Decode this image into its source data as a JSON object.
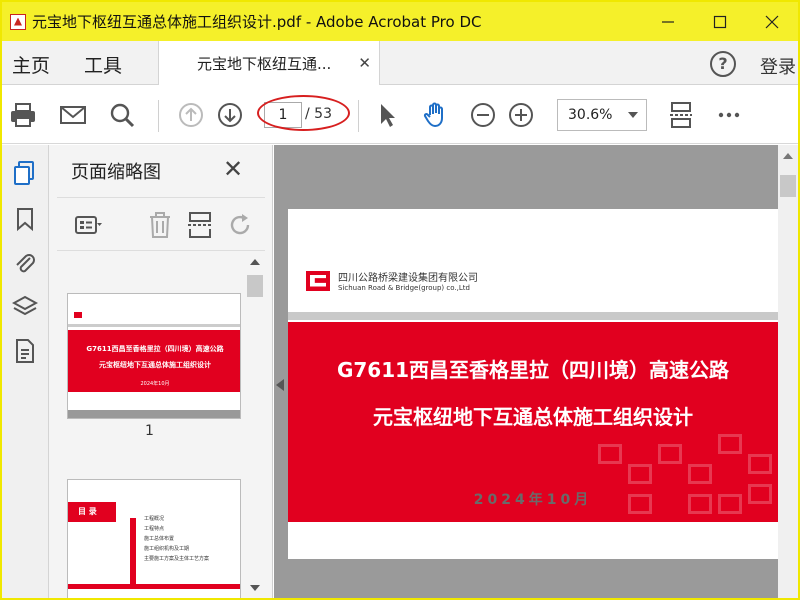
{
  "window": {
    "title": "元宝地下枢纽互通总体施工组织设计.pdf - Adobe Acrobat Pro DC",
    "accent_color": "#f5f02a"
  },
  "menubar": {
    "home": "主页",
    "tools": "工具",
    "doc_tab": "元宝地下枢纽互通...",
    "login": "登录"
  },
  "toolbar": {
    "current_page": "1",
    "total_pages": "/ 53",
    "zoom": "30.6%"
  },
  "panel": {
    "title": "页面缩略图",
    "thumbnail_label": "1"
  },
  "document": {
    "company_cn": "四川公路桥梁建设集团有限公司",
    "company_en": "Sichuan Road & Bridge(group) co.,Ltd",
    "title_line1": "G7611西昌至香格里拉（四川境）高速公路",
    "title_line2": "元宝枢纽地下互通总体施工组织设计",
    "date": "2024年10月",
    "brand_color": "#e1001f"
  },
  "thumbnail2": {
    "heading": "目 录",
    "items": [
      "工程概况",
      "工程特点",
      "施工总体布置",
      "施工组织机构及工期",
      "主要施工方案及主体工艺方案"
    ]
  }
}
